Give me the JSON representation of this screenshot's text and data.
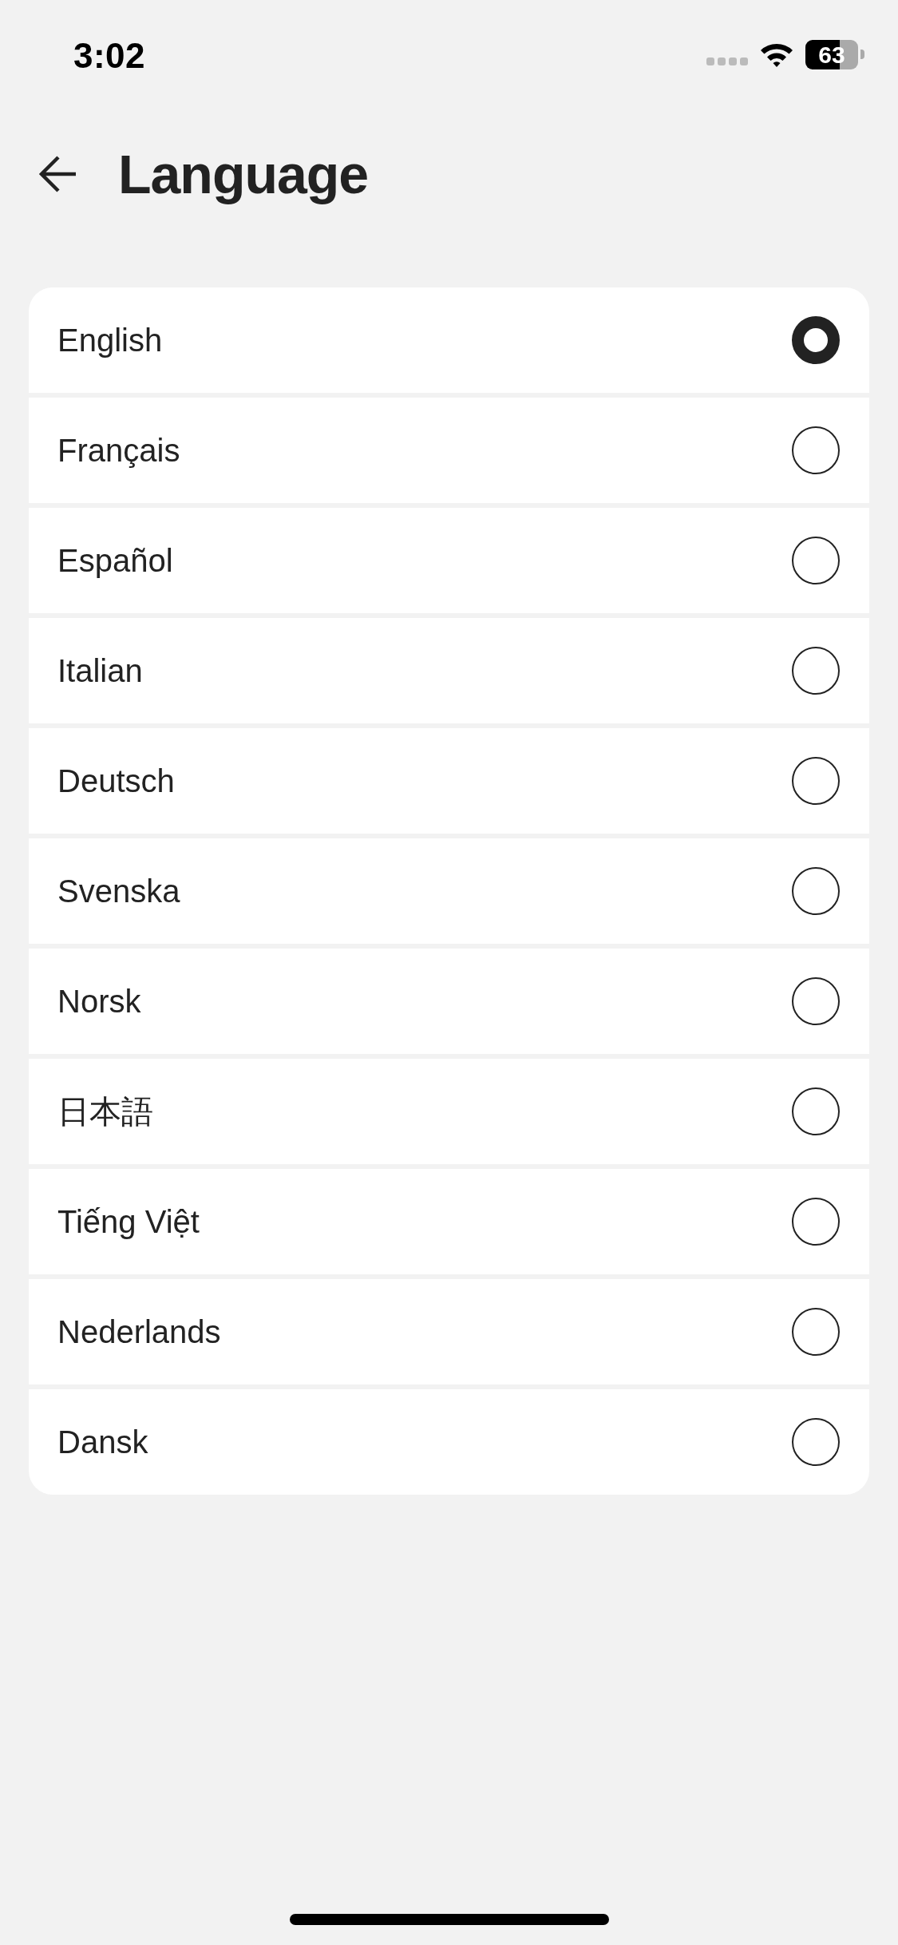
{
  "status_bar": {
    "time": "3:02",
    "battery": "63"
  },
  "header": {
    "title": "Language"
  },
  "languages": [
    {
      "label": "English",
      "selected": true
    },
    {
      "label": "Français",
      "selected": false
    },
    {
      "label": "Español",
      "selected": false
    },
    {
      "label": "Italian",
      "selected": false
    },
    {
      "label": "Deutsch",
      "selected": false
    },
    {
      "label": "Svenska",
      "selected": false
    },
    {
      "label": "Norsk",
      "selected": false
    },
    {
      "label": "日本語",
      "selected": false
    },
    {
      "label": "Tiếng Việt",
      "selected": false
    },
    {
      "label": "Nederlands",
      "selected": false
    },
    {
      "label": "Dansk",
      "selected": false
    }
  ]
}
